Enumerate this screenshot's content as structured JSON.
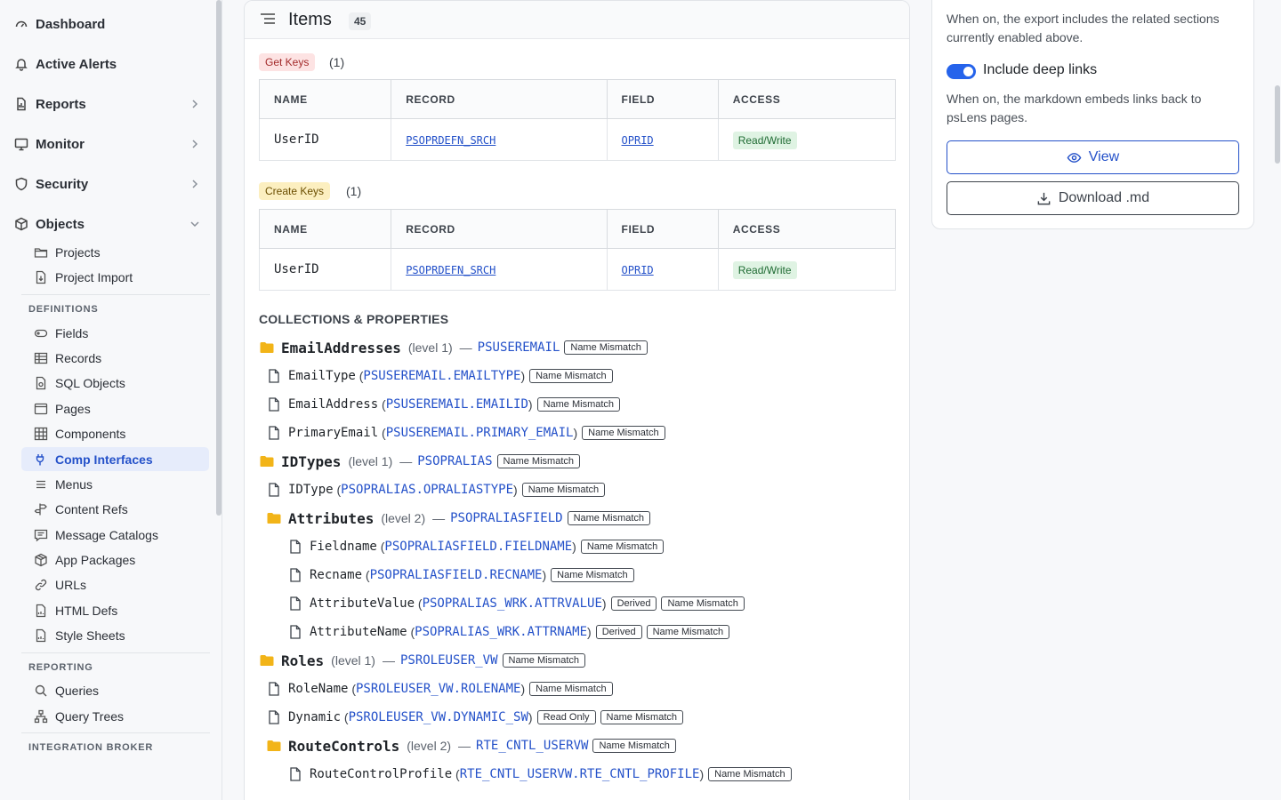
{
  "sidebar": {
    "top_items": [
      {
        "label": "Dashboard"
      },
      {
        "label": "Active Alerts"
      },
      {
        "label": "Reports"
      },
      {
        "label": "Monitor"
      },
      {
        "label": "Security"
      },
      {
        "label": "Objects"
      }
    ],
    "objects_items": [
      {
        "label": "Projects"
      },
      {
        "label": "Project Import"
      }
    ],
    "definitions_heading": "DEFINITIONS",
    "definitions_items": [
      {
        "label": "Fields"
      },
      {
        "label": "Records"
      },
      {
        "label": "SQL Objects"
      },
      {
        "label": "Pages"
      },
      {
        "label": "Components"
      },
      {
        "label": "Comp Interfaces"
      },
      {
        "label": "Menus"
      },
      {
        "label": "Content Refs"
      },
      {
        "label": "Message Catalogs"
      },
      {
        "label": "App Packages"
      },
      {
        "label": "URLs"
      },
      {
        "label": "HTML Defs"
      },
      {
        "label": "Style Sheets"
      }
    ],
    "reporting_heading": "REPORTING",
    "reporting_items": [
      {
        "label": "Queries"
      },
      {
        "label": "Query Trees"
      }
    ],
    "integration_heading": "INTEGRATION BROKER"
  },
  "items_card": {
    "title": "Items",
    "count": "45",
    "get_keys": {
      "label": "Get Keys",
      "count": "(1)",
      "columns": [
        "NAME",
        "RECORD",
        "FIELD",
        "ACCESS"
      ],
      "rows": [
        {
          "name": "UserID",
          "record": "PSOPRDEFN_SRCH",
          "field": "OPRID",
          "access": "Read/Write"
        }
      ]
    },
    "create_keys": {
      "label": "Create Keys",
      "count": "(1)",
      "columns": [
        "NAME",
        "RECORD",
        "FIELD",
        "ACCESS"
      ],
      "rows": [
        {
          "name": "UserID",
          "record": "PSOPRDEFN_SRCH",
          "field": "OPRID",
          "access": "Read/Write"
        }
      ]
    },
    "collections_title": "COLLECTIONS & PROPERTIES",
    "tree": [
      {
        "kind": "coll",
        "depth": 0,
        "name": "EmailAddresses",
        "level": "(level 1)",
        "record": "PSUSEREMAIL",
        "badges": [
          "Name Mismatch"
        ]
      },
      {
        "kind": "prop",
        "depth": 0,
        "name": "EmailType",
        "rec": "PSUSEREMAIL",
        "fld": "EMAILTYPE",
        "badges": [
          "Name Mismatch"
        ]
      },
      {
        "kind": "prop",
        "depth": 0,
        "name": "EmailAddress",
        "rec": "PSUSEREMAIL",
        "fld": "EMAILID",
        "badges": [
          "Name Mismatch"
        ]
      },
      {
        "kind": "prop",
        "depth": 0,
        "name": "PrimaryEmail",
        "rec": "PSUSEREMAIL",
        "fld": "PRIMARY_EMAIL",
        "badges": [
          "Name Mismatch"
        ]
      },
      {
        "kind": "coll",
        "depth": 0,
        "name": "IDTypes",
        "level": "(level 1)",
        "record": "PSOPRALIAS",
        "badges": [
          "Name Mismatch"
        ]
      },
      {
        "kind": "prop",
        "depth": 0,
        "name": "IDType",
        "rec": "PSOPRALIAS",
        "fld": "OPRALIASTYPE",
        "badges": [
          "Name Mismatch"
        ]
      },
      {
        "kind": "coll",
        "depth": 1,
        "name": "Attributes",
        "level": "(level 2)",
        "record": "PSOPRALIASFIELD",
        "badges": [
          "Name Mismatch"
        ]
      },
      {
        "kind": "prop",
        "depth": 1,
        "name": "Fieldname",
        "rec": "PSOPRALIASFIELD",
        "fld": "FIELDNAME",
        "badges": [
          "Name Mismatch"
        ]
      },
      {
        "kind": "prop",
        "depth": 1,
        "name": "Recname",
        "rec": "PSOPRALIASFIELD",
        "fld": "RECNAME",
        "badges": [
          "Name Mismatch"
        ]
      },
      {
        "kind": "prop",
        "depth": 1,
        "name": "AttributeValue",
        "rec": "PSOPRALIAS_WRK",
        "fld": "ATTRVALUE",
        "badges": [
          "Derived",
          "Name Mismatch"
        ]
      },
      {
        "kind": "prop",
        "depth": 1,
        "name": "AttributeName",
        "rec": "PSOPRALIAS_WRK",
        "fld": "ATTRNAME",
        "badges": [
          "Derived",
          "Name Mismatch"
        ]
      },
      {
        "kind": "coll",
        "depth": 0,
        "name": "Roles",
        "level": "(level 1)",
        "record": "PSROLEUSER_VW",
        "badges": [
          "Name Mismatch"
        ]
      },
      {
        "kind": "prop",
        "depth": 0,
        "name": "RoleName",
        "rec": "PSROLEUSER_VW",
        "fld": "ROLENAME",
        "badges": [
          "Name Mismatch"
        ]
      },
      {
        "kind": "prop",
        "depth": 0,
        "name": "Dynamic",
        "rec": "PSROLEUSER_VW",
        "fld": "DYNAMIC_SW",
        "badges": [
          "Read Only",
          "Name Mismatch"
        ]
      },
      {
        "kind": "coll",
        "depth": 1,
        "name": "RouteControls",
        "level": "(level 2)",
        "record": "RTE_CNTL_USERVW",
        "badges": [
          "Name Mismatch"
        ]
      },
      {
        "kind": "prop",
        "depth": 1,
        "name": "RouteControlProfile",
        "rec": "RTE_CNTL_USERVW",
        "fld": "RTE_CNTL_PROFILE",
        "badges": [
          "Name Mismatch"
        ]
      }
    ]
  },
  "export_panel": {
    "related_desc": "When on, the export includes the related sections currently enabled above.",
    "deep_links_label": "Include deep links",
    "deep_links_on": true,
    "deep_links_desc": "When on, the markdown embeds links back to psLens pages.",
    "view_label": "View",
    "download_label": "Download .md"
  },
  "colors": {
    "accent": "#2451c9",
    "toggle": "#2563eb",
    "folder": "#f2b418"
  }
}
